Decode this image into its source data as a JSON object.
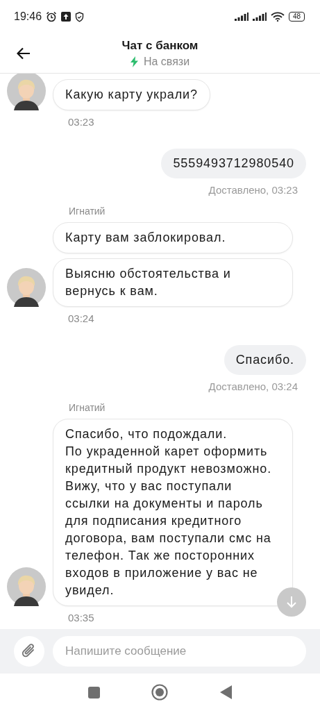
{
  "status_bar": {
    "time": "19:46",
    "battery": "48"
  },
  "header": {
    "title": "Чат с банком",
    "status": "На связи"
  },
  "messages": [
    {
      "kind": "incoming",
      "bubbles": [
        "Какую карту украли?"
      ],
      "time": "03:23"
    },
    {
      "kind": "outgoing",
      "text": "5559493712980540",
      "status": "Доставлено, 03:23"
    },
    {
      "kind": "incoming",
      "sender": "Игнатий",
      "bubbles": [
        "Карту вам заблокировал.",
        "Выясню обстоятельства и вернусь к вам."
      ],
      "time": "03:24"
    },
    {
      "kind": "outgoing",
      "text": "Спасибо.",
      "status": "Доставлено, 03:24"
    },
    {
      "kind": "incoming",
      "sender": "Игнатий",
      "bubbles": [
        "Спасибо, что подождали.\nПо украденной карет оформить кредитный продукт невозможно. Вижу, что у вас поступали ссылки на документы и пароль для подписания кредитного договора, вам поступали смс на телефон. Так же посторонних входов в приложение у вас не увидел."
      ],
      "time": "03:35"
    }
  ],
  "composer": {
    "placeholder": "Напишите сообщение"
  }
}
